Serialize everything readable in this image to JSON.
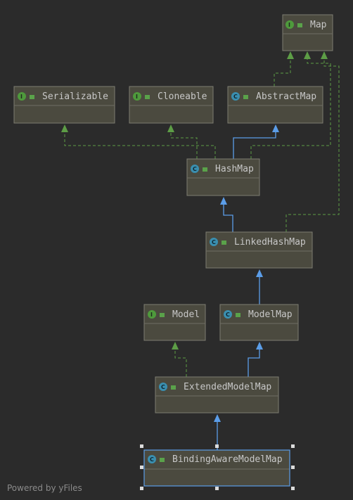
{
  "diagram": {
    "nodes": {
      "map": {
        "title": "Map",
        "kind": "interface",
        "icon": "interface-icon"
      },
      "serializable": {
        "title": "Serializable",
        "kind": "interface",
        "icon": "interface-icon"
      },
      "cloneable": {
        "title": "Cloneable",
        "kind": "interface",
        "icon": "interface-icon"
      },
      "abstractmap": {
        "title": "AbstractMap",
        "kind": "abstract-class",
        "icon": "abstract-class-icon"
      },
      "hashmap": {
        "title": "HashMap",
        "kind": "class",
        "icon": "class-icon"
      },
      "linkedhashmap": {
        "title": "LinkedHashMap",
        "kind": "class",
        "icon": "class-icon"
      },
      "model": {
        "title": "Model",
        "kind": "interface",
        "icon": "interface-icon"
      },
      "modelmap": {
        "title": "ModelMap",
        "kind": "class",
        "icon": "class-icon"
      },
      "extendedmodelmap": {
        "title": "ExtendedModelMap",
        "kind": "class",
        "icon": "class-icon"
      },
      "bindingawaremodelmap": {
        "title": "BindingAwareModelMap",
        "kind": "class",
        "icon": "class-icon",
        "selected": true
      }
    },
    "edges": [
      {
        "from": "abstractmap",
        "to": "map",
        "type": "implements"
      },
      {
        "from": "hashmap",
        "to": "map",
        "type": "implements"
      },
      {
        "from": "linkedhashmap",
        "to": "map",
        "type": "implements"
      },
      {
        "from": "hashmap",
        "to": "serializable",
        "type": "implements"
      },
      {
        "from": "hashmap",
        "to": "cloneable",
        "type": "implements"
      },
      {
        "from": "hashmap",
        "to": "abstractmap",
        "type": "extends"
      },
      {
        "from": "linkedhashmap",
        "to": "hashmap",
        "type": "extends"
      },
      {
        "from": "modelmap",
        "to": "linkedhashmap",
        "type": "extends"
      },
      {
        "from": "extendedmodelmap",
        "to": "model",
        "type": "implements"
      },
      {
        "from": "extendedmodelmap",
        "to": "modelmap",
        "type": "extends"
      },
      {
        "from": "bindingawaremodelmap",
        "to": "extendedmodelmap",
        "type": "extends"
      }
    ],
    "colors": {
      "background": "#2b2b2b",
      "node_fill": "#4b4a3f",
      "implements_edge": "#5d9d46",
      "extends_edge": "#5b9de8",
      "interface_badge": "#4e9a3c",
      "class_badge": "#3a8fb0"
    }
  },
  "badges": {
    "interface": "I",
    "class": "C"
  },
  "footer": {
    "watermark": "Powered by yFiles"
  }
}
